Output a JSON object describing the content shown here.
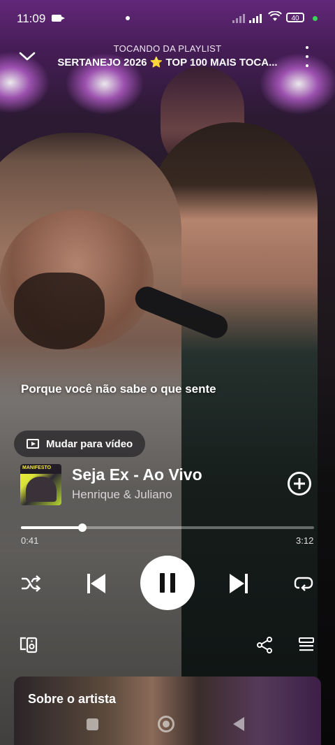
{
  "status_bar": {
    "time": "11:09",
    "battery": "40"
  },
  "header": {
    "context_label": "TOCANDO DA PLAYLIST",
    "playlist_title": "SERTANEJO 2026 ⭐ TOP 100 MAIS TOCA..."
  },
  "lyrics": {
    "current_line": "Porque você não sabe o que sente"
  },
  "switch_video_label": "Mudar para vídeo",
  "track": {
    "title": "Seja Ex - Ao Vivo",
    "artist": "Henrique & Juliano",
    "art_text": "MANIFESTO"
  },
  "playback": {
    "elapsed": "0:41",
    "total": "3:12",
    "progress_fraction": 0.21,
    "state": "playing"
  },
  "controls": {
    "shuffle_icon": "shuffle-icon",
    "previous_icon": "skip-previous-icon",
    "pause_icon": "pause-icon",
    "next_icon": "skip-next-icon",
    "repeat_icon": "repeat-icon",
    "devices_icon": "devices-icon",
    "share_icon": "share-icon",
    "queue_icon": "queue-icon"
  },
  "artist_card": {
    "title": "Sobre o artista"
  },
  "colors": {
    "accent_progress": "#ffffff",
    "status_dot": "#3cd35a"
  }
}
